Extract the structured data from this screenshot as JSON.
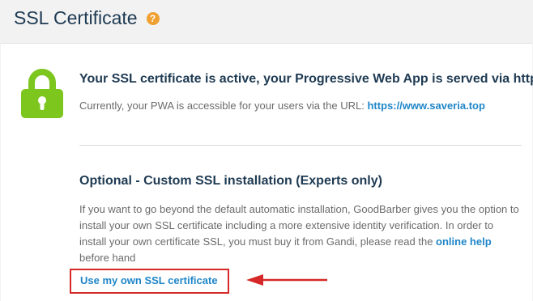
{
  "header": {
    "title": "SSL Certificate",
    "help_icon": "?"
  },
  "status": {
    "title": "Your SSL certificate is active, your Progressive Web App is served via https",
    "text": "Currently, your PWA is accessible for your users via the URL: ",
    "url": "https://www.saveria.top"
  },
  "optional": {
    "title": "Optional - Custom SSL installation (Experts only)",
    "text_1": "If you want to go beyond the default automatic installation, GoodBarber gives you the option to install your own SSL certificate including a more extensive identity verification. In order to install your own certificate SSL, you must buy it from Gandi, please read the ",
    "help_link": "online help",
    "text_2": " before hand",
    "button_label": "Use my own SSL certificate"
  },
  "colors": {
    "accent": "#1f86c8",
    "lock_green": "#7cc61e",
    "highlight_red": "#d62828",
    "help_orange": "#f0a030"
  },
  "icons": {
    "lock": "lock-icon",
    "help": "help-icon",
    "arrow": "arrow-left-icon"
  }
}
